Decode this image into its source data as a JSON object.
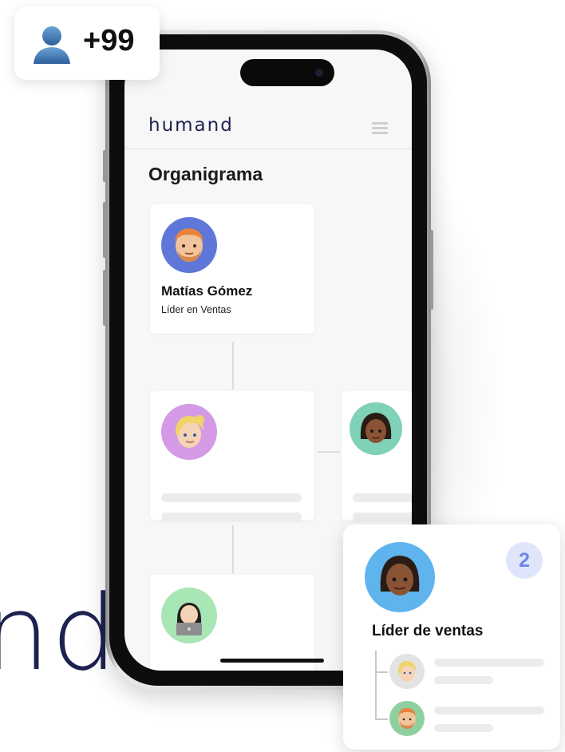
{
  "badge": {
    "count": "+99",
    "icon": "user-icon"
  },
  "background": {
    "brand_text": "nd"
  },
  "app": {
    "logo": "humand",
    "menu_icon": "hamburger-icon",
    "page_title": "Organigrama"
  },
  "org_chart": {
    "root": {
      "name": "Matías Gómez",
      "role": "Líder en Ventas",
      "avatar_color": "#5f77d8"
    },
    "level2": [
      {
        "avatar_color": "#d49ae6"
      },
      {
        "avatar_color": "#7fd1b7"
      }
    ],
    "level3": [
      {
        "avatar_color": "#a8e6b5"
      }
    ]
  },
  "team_card": {
    "count": "2",
    "title": "Líder de ventas",
    "leader_avatar_color": "#5fb4ee",
    "members": [
      {
        "avatar_color": "#e3e3e3"
      },
      {
        "avatar_color": "#8fd0a0"
      }
    ]
  },
  "colors": {
    "brand": "#1e2251",
    "count_badge_bg": "#dfe6fb",
    "count_badge_text": "#6d86e5",
    "placeholder_bar": "#ececec"
  }
}
